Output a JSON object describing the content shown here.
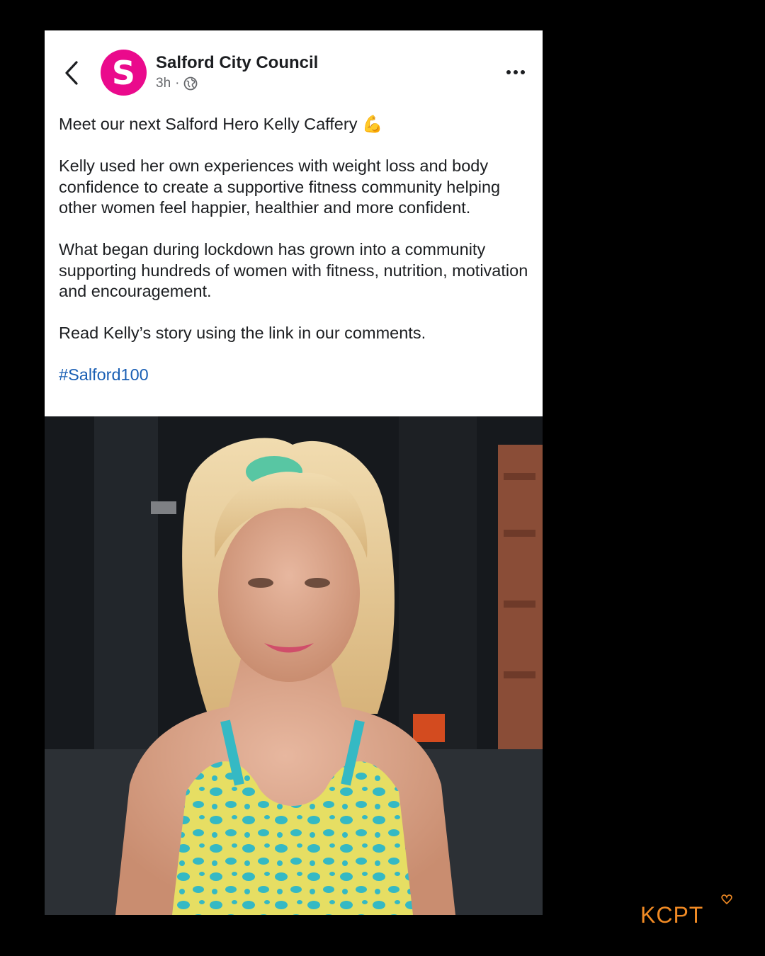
{
  "post": {
    "page_name": "Salford City Council",
    "avatar_letter": "S",
    "timestamp": "3h",
    "separator": "·",
    "paragraphs": [
      "Meet our next Salford Hero Kelly Caffery 💪",
      "Kelly used her own experiences with weight loss and body confidence to create a supportive fitness community helping other women feel happier, healthier and more confident.",
      "What began during lockdown has grown into a community supporting hundreds of women with fitness, nutrition, motivation and encouragement.",
      "Read Kelly’s story using the link in our comments."
    ],
    "hashtag": "#Salford100"
  },
  "icons": {
    "back": "chevron-left-icon",
    "audience": "globe-icon",
    "more": "more-horizontal-icon"
  },
  "watermark": {
    "text": "KCPT"
  },
  "colors": {
    "background": "#000000",
    "avatar": "#ea0a8c",
    "hashtag": "#1a5fb4",
    "logo": "#f08a24",
    "text": "#1c1e21",
    "meta": "#65676b"
  }
}
